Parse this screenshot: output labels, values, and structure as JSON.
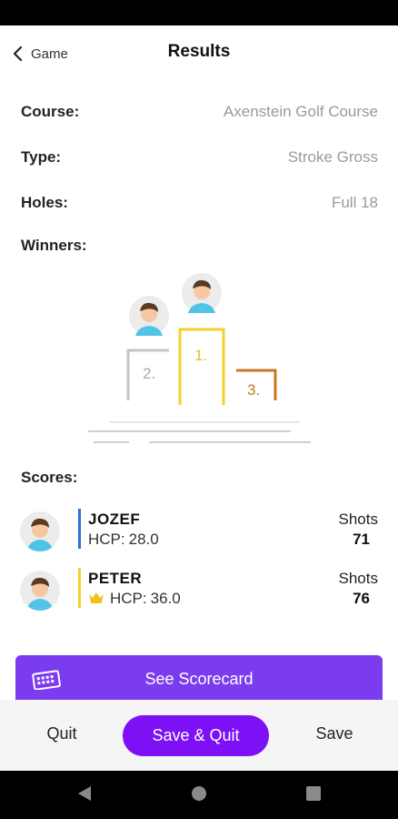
{
  "header": {
    "back_label": "Game",
    "title": "Results"
  },
  "info": {
    "course_label": "Course:",
    "course_value": "Axenstein Golf Course",
    "type_label": "Type:",
    "type_value": "Stroke Gross",
    "holes_label": "Holes:",
    "holes_value": "Full 18",
    "winners_label": "Winners:"
  },
  "podium": {
    "first": "1.",
    "second": "2.",
    "third": "3.",
    "colors": {
      "first": "#f2d22a",
      "second": "#c4c4c4",
      "third": "#c9771e"
    }
  },
  "scores": {
    "label": "Scores:",
    "players": [
      {
        "name": "JOZEF",
        "hcp_label": "HCP:",
        "hcp_value": "28.0",
        "shots_label": "Shots",
        "shots": "71",
        "bar_color": "#2f6fd6",
        "crown": false
      },
      {
        "name": "PETER",
        "hcp_label": "HCP:",
        "hcp_value": "36.0",
        "shots_label": "Shots",
        "shots": "76",
        "bar_color": "#f2d22a",
        "crown": true
      }
    ]
  },
  "scorecard": {
    "label": "See Scorecard",
    "icon": "scorecard-icon"
  },
  "actions": {
    "quit": "Quit",
    "save_quit": "Save & Quit",
    "save": "Save"
  },
  "colors": {
    "accent": "#7b3cf0",
    "primary_button": "#7d10f5"
  }
}
